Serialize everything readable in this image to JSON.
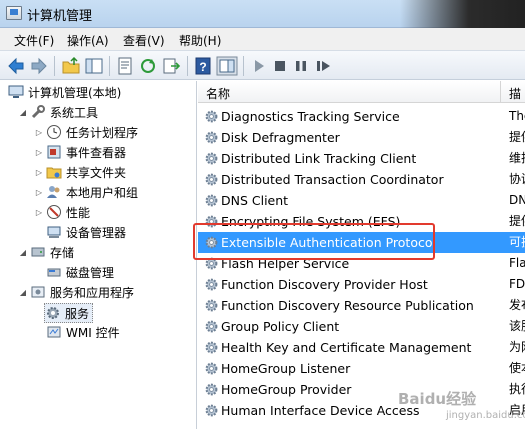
{
  "window": {
    "title": "计算机管理"
  },
  "menu": [
    {
      "label": "文件(F)"
    },
    {
      "label": "操作(A)"
    },
    {
      "label": "查看(V)"
    },
    {
      "label": "帮助(H)"
    }
  ],
  "tree": {
    "root": "计算机管理(本地)",
    "system_tools": "系统工具",
    "task_scheduler": "任务计划程序",
    "event_viewer": "事件查看器",
    "shared_folders": "共享文件夹",
    "local_users": "本地用户和组",
    "performance": "性能",
    "device_manager": "设备管理器",
    "storage": "存储",
    "disk_management": "磁盘管理",
    "services_apps": "服务和应用程序",
    "services": "服务",
    "wmi": "WMI 控件"
  },
  "list": {
    "header_name": "名称",
    "header_desc": "描",
    "rows": [
      {
        "name": "Diagnostics Tracking Service",
        "desc": "The"
      },
      {
        "name": "Disk Defragmenter",
        "desc": "提供"
      },
      {
        "name": "Distributed Link Tracking Client",
        "desc": "维护"
      },
      {
        "name": "Distributed Transaction Coordinator",
        "desc": "协调"
      },
      {
        "name": "DNS Client",
        "desc": "DN"
      },
      {
        "name": "Encrypting File System (EFS)",
        "desc": "提供"
      },
      {
        "name": "Extensible Authentication Protocol",
        "desc": "可扩"
      },
      {
        "name": "Flash Helper Service",
        "desc": "Fla"
      },
      {
        "name": "Function Discovery Provider Host",
        "desc": "FD"
      },
      {
        "name": "Function Discovery Resource Publication",
        "desc": "发布"
      },
      {
        "name": "Group Policy Client",
        "desc": "该服"
      },
      {
        "name": "Health Key and Certificate Management",
        "desc": "为网"
      },
      {
        "name": "HomeGroup Listener",
        "desc": "使本"
      },
      {
        "name": "HomeGroup Provider",
        "desc": "执行"
      },
      {
        "name": "Human Interface Device Access",
        "desc": "启用"
      }
    ]
  },
  "watermark": {
    "main": "Baidu经验",
    "sub": "jingyan.baidu.com"
  },
  "colors": {
    "selection": "#3399ff",
    "highlight_box": "#e23a2e"
  }
}
